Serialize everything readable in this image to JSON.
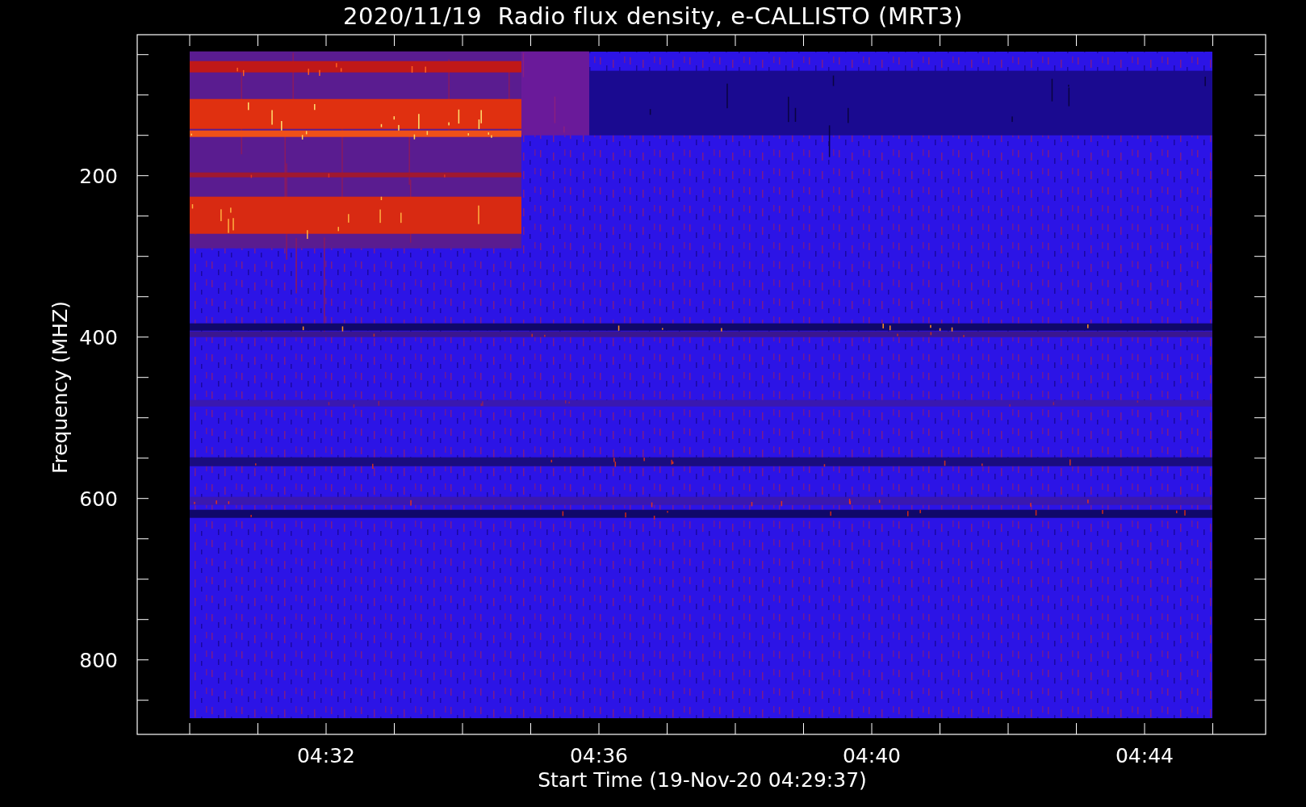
{
  "title": "2020/11/19  Radio flux density, e-CALLISTO (MRT3)",
  "y_axis": {
    "label": "Frequency (MHZ)",
    "ticks": [
      "200",
      "400",
      "600",
      "800"
    ]
  },
  "x_axis": {
    "label": "Start Time (19-Nov-20 04:29:37)",
    "ticks": [
      "04:32",
      "04:36",
      "04:40",
      "04:44"
    ]
  }
}
